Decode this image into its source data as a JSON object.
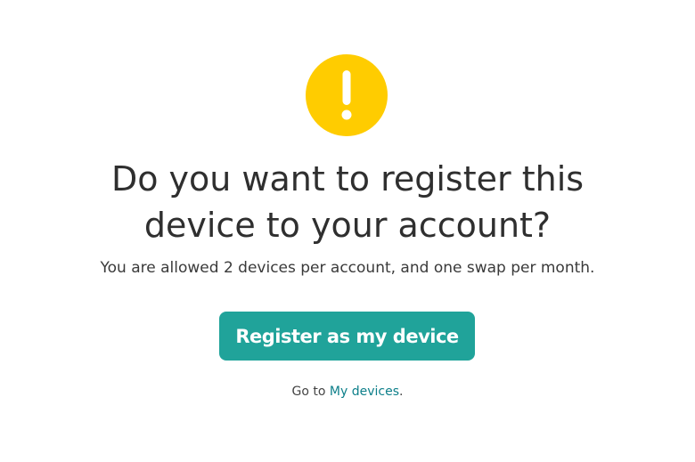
{
  "icon": {
    "name": "exclamation-icon",
    "color": "#FFCC00",
    "glyph_color": "#FFFFFF"
  },
  "headline": {
    "line1": "Do you want to register this",
    "line2": "device to your account?"
  },
  "subtext": "You are allowed 2 devices per account, and one swap per month.",
  "register_button": {
    "label": "Register as my device",
    "color": "#20A39A"
  },
  "goto": {
    "prefix": "Go to ",
    "link_label": "My devices",
    "suffix": ".",
    "link_color": "#0D7F8A"
  }
}
